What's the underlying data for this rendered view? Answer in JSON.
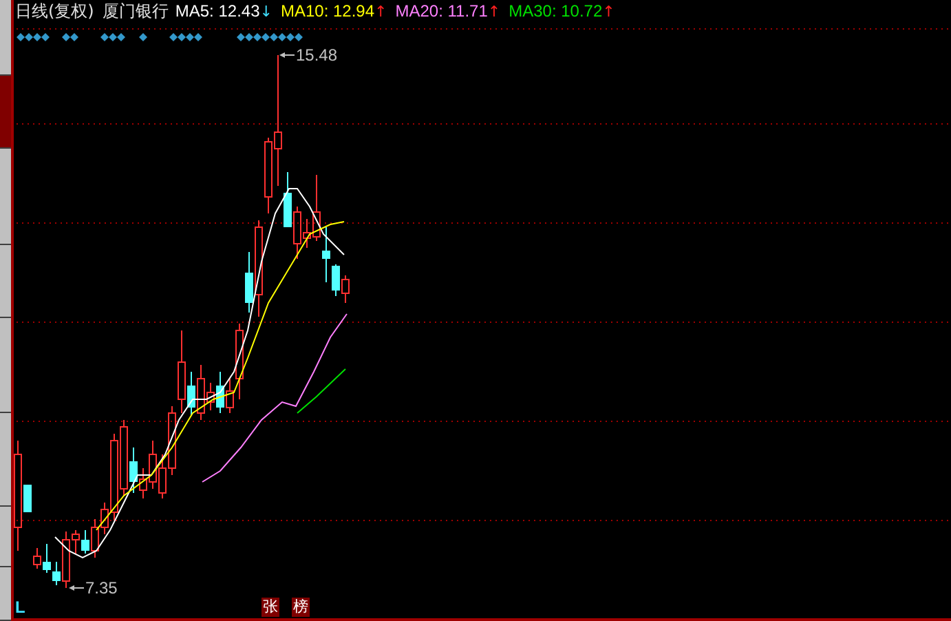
{
  "side_tabs": [
    {
      "selected": false
    },
    {
      "selected": true
    },
    {
      "selected": false
    },
    {
      "selected": false
    },
    {
      "selected": false
    },
    {
      "selected": false
    },
    {
      "selected": false
    },
    {
      "selected": false
    }
  ],
  "header": {
    "period": "日线(复权)",
    "stock_name": "厦门银行",
    "indicators": [
      {
        "label": "MA5: 12.43",
        "arrow": {
          "text": "↓",
          "color": "#40e0ff"
        },
        "color": "#ffffff"
      },
      {
        "label": "MA10: 12.94",
        "arrow": {
          "text": "↑",
          "color": "#ff2020"
        },
        "color": "#ffff00"
      },
      {
        "label": "MA20: 11.71",
        "arrow": {
          "text": "↑",
          "color": "#ff2020"
        },
        "color": "#ff80ff"
      },
      {
        "label": "MA30: 10.72",
        "arrow": {
          "text": "↑",
          "color": "#ff2020"
        },
        "color": "#00e000"
      }
    ]
  },
  "chart": {
    "high_label": "15.48",
    "low_label": "7.35",
    "corner_label": "L",
    "bottom_badges": [
      "张",
      "榜"
    ]
  }
}
